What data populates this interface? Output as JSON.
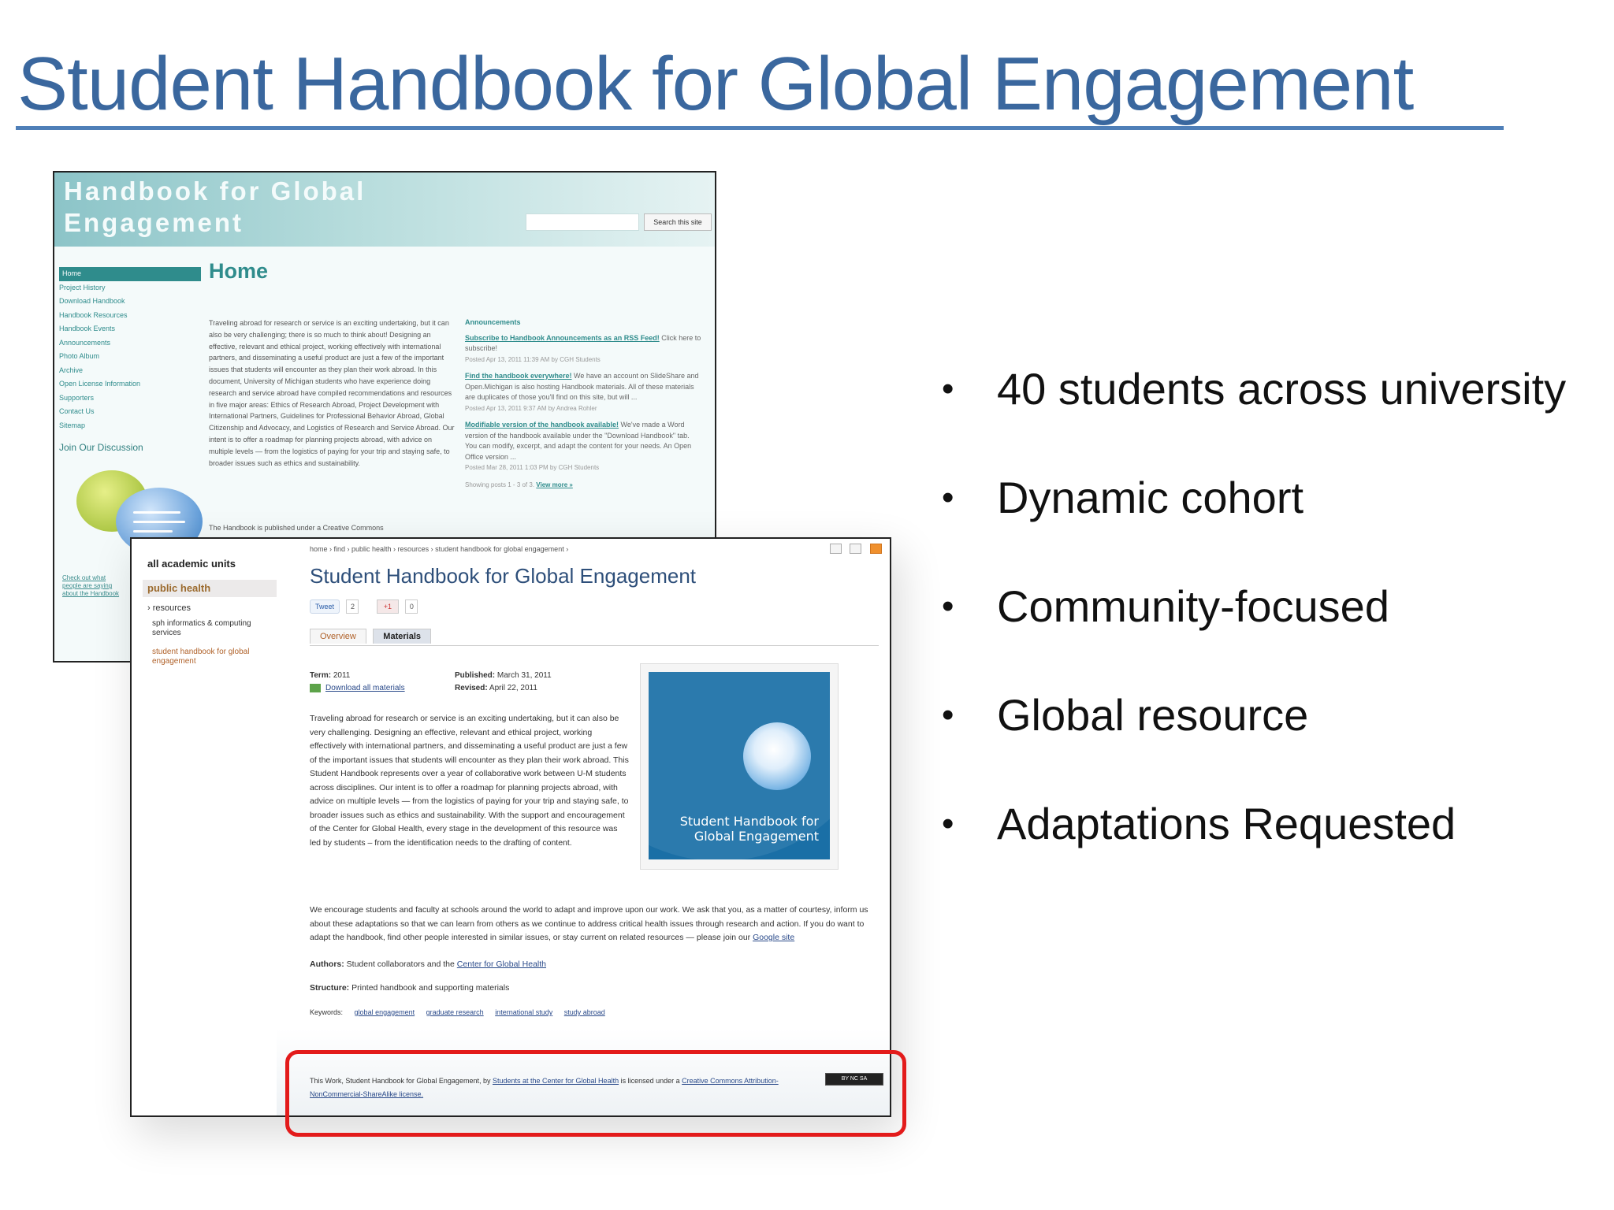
{
  "slide": {
    "title": "Student Handbook for Global Engagement",
    "bullets": [
      "40 students across university",
      "Dynamic cohort",
      "Community-focused",
      "Global resource",
      "Adaptations Requested"
    ]
  },
  "back_screenshot": {
    "banner_title": "Handbook for Global Engagement",
    "search_button": "Search this site",
    "nav": [
      "Home",
      "Project History",
      "Download Handbook",
      "Handbook Resources",
      "Handbook Events",
      "Announcements",
      "Photo Album",
      "Archive",
      "Open License Information",
      "Supporters",
      "Contact Us",
      "Sitemap"
    ],
    "join": "Join Our Discussion",
    "check_link": "Check out what people are saying about the Handbook",
    "page_heading": "Home",
    "intro_text": "Traveling abroad for research or service is an exciting undertaking, but it can also be very challenging; there is so much to think about! Designing an effective, relevant and ethical project, working effectively with international partners, and disseminating a useful product are just a few of the important issues that students will encounter as they plan their work abroad. In this document, University of Michigan students who have experience doing research and service abroad have compiled recommendations and resources in five major areas: Ethics of Research Abroad, Project Development with International Partners, Guidelines for Professional Behavior Abroad, Global Citizenship and Advocacy, and Logistics of Research and Service Abroad. Our intent is to offer a roadmap for planning projects abroad, with advice on multiple levels — from the logistics of paying for your trip and staying safe, to broader issues such as ethics and sustainability.",
    "footnote": "The Handbook is published under a Creative Commons",
    "announcements": {
      "heading": "Announcements",
      "items": [
        {
          "link": "Subscribe to Handbook Announcements as an RSS Feed!",
          "text": "Click here to subscribe!",
          "meta": "Posted Apr 13, 2011 11:39 AM by CGH Students"
        },
        {
          "link": "Find the handbook everywhere!",
          "text": "We have an account on SlideShare and Open.Michigan is also hosting Handbook materials. All of these materials are duplicates of those you'll find on this site, but will ...",
          "meta": "Posted Apr 13, 2011 9:37 AM by Andrea Rohler"
        },
        {
          "link": "Modifiable version of the handbook available!",
          "text": "We've made a Word version of the handbook available under the \"Download Handbook\" tab. You can modify, excerpt, and adapt the content for your needs. An Open Office version ...",
          "meta": "Posted Mar 28, 2011 1:03 PM by CGH Students"
        }
      ],
      "showing": "Showing posts 1 - 3 of 3.",
      "view_more": "View more »"
    }
  },
  "front_screenshot": {
    "sidebar": {
      "all_units": "all academic units",
      "public_health": "public health",
      "resources": "› resources",
      "sph": "sph informatics & computing services",
      "student_handbook": "student handbook for global engagement"
    },
    "breadcrumb": "home › find › public health › resources › student handbook for global engagement ›",
    "title": "Student Handbook for Global Engagement",
    "tweet_label": "Tweet",
    "tweet_count": "2",
    "gplus_label": "+1",
    "gplus_count": "0",
    "tabs": [
      "Overview",
      "Materials"
    ],
    "term_label": "Term:",
    "term_value": "2011",
    "download_link": "Download all materials",
    "published_label": "Published:",
    "published_value": "March 31, 2011",
    "revised_label": "Revised:",
    "revised_value": "April 22, 2011",
    "body_text": "Traveling abroad for research or service is an exciting undertaking, but it can also be very challenging. Designing an effective, relevant and ethical project, working effectively with international partners, and disseminating a useful product are just a few of the important issues that students will encounter as they plan their work abroad. This Student Handbook represents over a year of collaborative work between U-M students across disciplines. Our intent is to offer a roadmap for planning projects abroad, with advice on multiple levels — from the logistics of paying for your trip and staying safe, to broader issues such as ethics and sustainability. With the support and encouragement of the Center for Global Health, every stage in the development of this resource was led by students – from the identification needs to the drafting of content.",
    "cover_text": "Student Handbook for Global Engagement",
    "encourage_text": "We encourage students and faculty at schools around the world to adapt and improve upon our work. We ask that you, as a matter of courtesy, inform us about these adaptations so that we can learn from others as we continue to address critical health issues through research and action. If you do want to adapt the handbook, find other people interested in similar issues, or stay current on related resources — please join our",
    "google_site": "Google site",
    "authors_label": "Authors:",
    "authors_text": "Student collaborators and the",
    "authors_link": "Center for Global Health",
    "structure_label": "Structure:",
    "structure_text": "Printed handbook and supporting materials",
    "keywords_label": "Keywords:",
    "keywords": [
      "global engagement",
      "graduate research",
      "international study",
      "study abroad"
    ],
    "license_text": "This Work, Student Handbook for Global Engagement, by",
    "license_link": "Students at the Center for Global Health",
    "license_mid": "is licensed under a",
    "license_cc": "Creative Commons Attribution-NonCommercial-ShareAlike license.",
    "cc_badge": "BY NC SA"
  },
  "colors": {
    "title": "#3a679e",
    "rule": "#4f7fb8",
    "highlight": "#e31b1b",
    "teal": "#2f8c8c",
    "cover": "#1a6fa6"
  }
}
